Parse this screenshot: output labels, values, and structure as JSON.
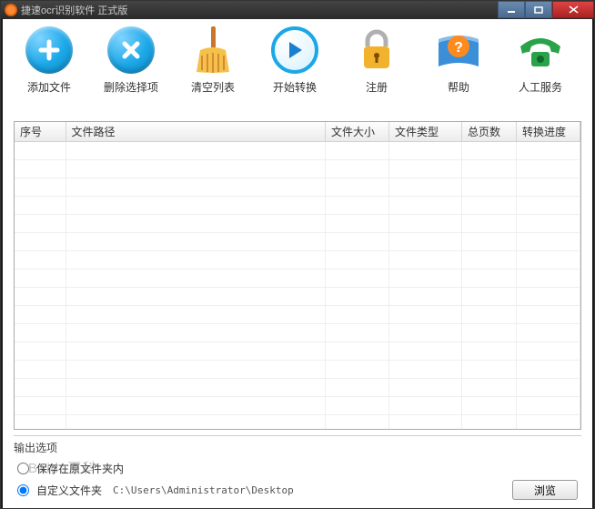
{
  "window": {
    "title": "捷速ocr识别软件 正式版"
  },
  "toolbar": {
    "add": {
      "label": "添加文件"
    },
    "remove": {
      "label": "删除选择项"
    },
    "clear": {
      "label": "清空列表"
    },
    "start": {
      "label": "开始转换"
    },
    "reg": {
      "label": "注册"
    },
    "help": {
      "label": "帮助"
    },
    "support": {
      "label": "人工服务"
    }
  },
  "table": {
    "headers": {
      "index": "序号",
      "path": "文件路径",
      "size": "文件大小",
      "type": "文件类型",
      "pages": "总页数",
      "progress": "转换进度"
    }
  },
  "output": {
    "title": "输出选项",
    "save_in_src": "保存在原文件夹内",
    "custom_folder": "自定义文件夹",
    "path": "C:\\Users\\Administrator\\Desktop",
    "browse": "浏览",
    "selected": "custom"
  },
  "watermark": "Baidu百科"
}
